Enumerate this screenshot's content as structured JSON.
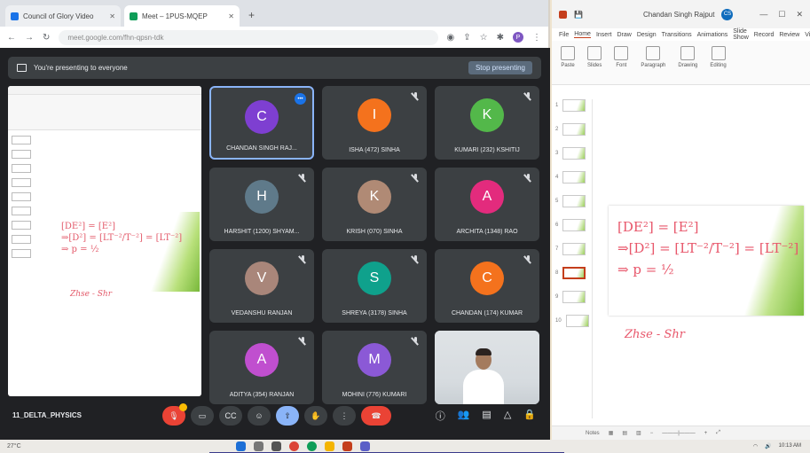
{
  "browser": {
    "tabs": [
      {
        "title": "Council of Glory Video",
        "color": "#1a73e8"
      },
      {
        "title": "Meet – 1PUS-MQEP",
        "color": "#0f9d58"
      }
    ],
    "url": "meet.google.com/fhn-qpsn-tdk"
  },
  "meet": {
    "presenting_text": "You're presenting to everyone",
    "stop_label": "Stop presenting",
    "meeting_code": "11_DELTA_PHYSICS",
    "participants": [
      {
        "initial": "C",
        "name": "CHANDAN SINGH RAJ...",
        "color": "#7e3fd1",
        "speaking": true
      },
      {
        "initial": "I",
        "name": "ISHA (472) SINHA",
        "color": "#f4721d"
      },
      {
        "initial": "K",
        "name": "KUMARI (232) KSHITIJ",
        "color": "#53b84a"
      },
      {
        "initial": "H",
        "name": "HARSHIT (1200) SHYAM...",
        "color": "#5f7a8a"
      },
      {
        "initial": "K",
        "name": "KRISH (070) SINHA",
        "color": "#b08a75"
      },
      {
        "initial": "A",
        "name": "ARCHITA (1348) RAO",
        "color": "#e32b7d"
      },
      {
        "initial": "V",
        "name": "VEDANSHU RANJAN",
        "color": "#a9867a"
      },
      {
        "initial": "S",
        "name": "SHREYA (3178) SINHA",
        "color": "#0fa18c"
      },
      {
        "initial": "C",
        "name": "CHANDAN (174) KUMAR",
        "color": "#f4721d"
      },
      {
        "initial": "A",
        "name": "ADITYA (354) RANJAN",
        "color": "#c04fcf"
      },
      {
        "initial": "M",
        "name": "MOHINI (776) KUMARI",
        "color": "#8b59d6"
      }
    ],
    "controls": [
      "mic",
      "camera",
      "captions",
      "emoji",
      "present",
      "raise-hand",
      "more",
      "end-call"
    ],
    "right_controls": [
      "info",
      "people",
      "chat",
      "activities",
      "lock"
    ]
  },
  "ppt": {
    "file": "Chandan Singh Rajput",
    "menu": [
      "File",
      "Home",
      "Insert",
      "Draw",
      "Design",
      "Transitions",
      "Animations",
      "Slide Show",
      "Record",
      "Review",
      "View",
      "Help"
    ],
    "ribbon_groups": [
      "Paste",
      "Slides",
      "Font",
      "Paragraph",
      "Drawing",
      "Editing"
    ],
    "slide_count": 10,
    "slide_numbers": [
      "1",
      "2",
      "3",
      "4",
      "5",
      "6",
      "7",
      "8",
      "9",
      "10"
    ],
    "slide_line1": "[DE²] = [E²]",
    "slide_line2": "⇒[D²] = [LT⁻²/T⁻²] = [LT⁻²]",
    "slide_line3": "⇒ p = ½",
    "notes_text": "Zhse - Shr",
    "status": "Notes"
  },
  "taskbar": {
    "weather": "27°C",
    "time": "10:13 AM"
  }
}
